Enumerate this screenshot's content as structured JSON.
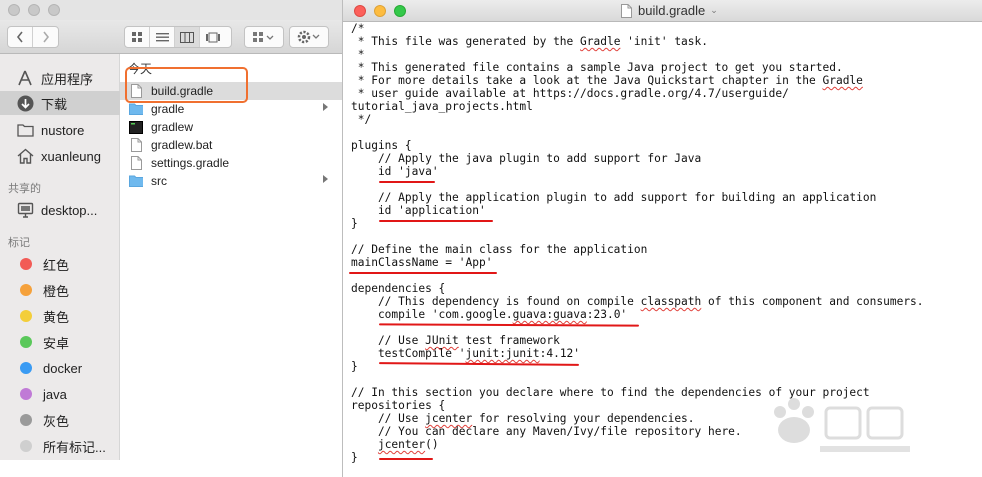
{
  "finder": {
    "sidebar": {
      "favorites": [
        {
          "label": "应用程序",
          "icon": "applications-icon"
        },
        {
          "label": "下载",
          "icon": "downloads-icon",
          "selected": true
        },
        {
          "label": "nustore",
          "icon": "folder-icon"
        },
        {
          "label": "xuanleung",
          "icon": "home-icon"
        }
      ],
      "shared_header": "共享的",
      "shared": [
        {
          "label": "desktop...",
          "icon": "computer-icon"
        }
      ],
      "tags_header": "标记",
      "tags": [
        {
          "label": "红色",
          "color": "#f25b56"
        },
        {
          "label": "橙色",
          "color": "#f5a13b"
        },
        {
          "label": "黄色",
          "color": "#f3ce3a"
        },
        {
          "label": "安卓",
          "color": "#5ac85a"
        },
        {
          "label": "docker",
          "color": "#3a9bf3"
        },
        {
          "label": "java",
          "color": "#c07ad6"
        },
        {
          "label": "灰色",
          "color": "#9a9a9a"
        },
        {
          "label": "所有标记...",
          "color": "#cfcfcf"
        }
      ]
    },
    "list": {
      "column_header": "今天",
      "files": [
        {
          "name": "build.gradle",
          "type": "document",
          "selected": true
        },
        {
          "name": "gradle",
          "type": "folder",
          "expandable": true
        },
        {
          "name": "gradlew",
          "type": "executable"
        },
        {
          "name": "gradlew.bat",
          "type": "document"
        },
        {
          "name": "settings.gradle",
          "type": "document"
        },
        {
          "name": "src",
          "type": "folder",
          "expandable": true
        }
      ]
    },
    "accent_highlight": "#f07030"
  },
  "editor": {
    "title": "build.gradle",
    "traffic_lights": {
      "close": "#fc605b",
      "minimize": "#fdbc40",
      "zoom": "#34c84a"
    },
    "lines": [
      "/*",
      " * This file was generated by the Gradle 'init' task.",
      " *",
      " * This generated file contains a sample Java project to get you started.",
      " * For more details take a look at the Java Quickstart chapter in the Gradle",
      " * user guide available at https://docs.gradle.org/4.7/userguide/",
      "tutorial_java_projects.html",
      " */",
      "",
      "plugins {",
      "    // Apply the java plugin to add support for Java",
      "    id 'java'",
      "",
      "    // Apply the application plugin to add support for building an application",
      "    id 'application'",
      "}",
      "",
      "// Define the main class for the application",
      "mainClassName = 'App'",
      "",
      "dependencies {",
      "    // This dependency is found on compile classpath of this component and consumers.",
      "    compile 'com.google.guava:guava:23.0'",
      "",
      "    // Use JUnit test framework",
      "    testCompile 'junit:junit:4.12'",
      "}",
      "",
      "// In this section you declare where to find the dependencies of your project",
      "repositories {",
      "    // Use jcenter for resolving your dependencies.",
      "    // You can declare any Maven/Ivy/file repository here.",
      "    jcenter()",
      "}"
    ],
    "annotation_color": "#e11717"
  }
}
